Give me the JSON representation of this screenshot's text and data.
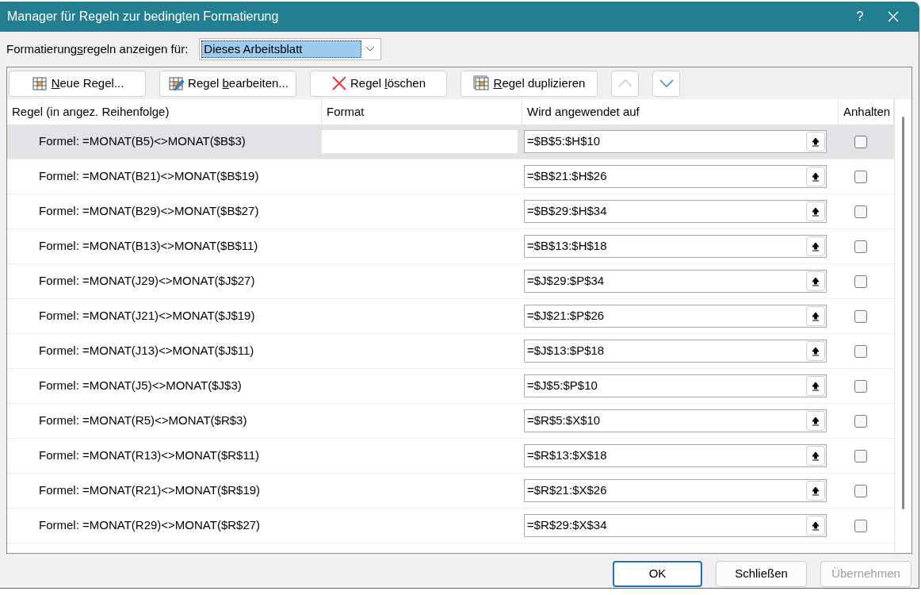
{
  "window": {
    "title": "Manager für Regeln zur bedingten Formatierung",
    "help": "?"
  },
  "scope": {
    "label": [
      {
        "t": "Formatierung",
        "u": false
      },
      {
        "t": "s",
        "u": true
      },
      {
        "t": "regeln anzeigen für:",
        "u": false
      }
    ],
    "value": "Dieses Arbeitsblatt"
  },
  "toolbar": [
    {
      "kind": "new",
      "label": [
        {
          "t": "N",
          "u": true
        },
        {
          "t": "eue Regel...",
          "u": false
        }
      ]
    },
    {
      "kind": "edit",
      "label": [
        {
          "t": "Regel ",
          "u": false
        },
        {
          "t": "b",
          "u": true
        },
        {
          "t": "earbeiten...",
          "u": false
        }
      ]
    },
    {
      "kind": "delete",
      "label": [
        {
          "t": "Regel ",
          "u": false
        },
        {
          "t": "l",
          "u": true
        },
        {
          "t": "öschen",
          "u": false
        }
      ]
    },
    {
      "kind": "duplicate",
      "label": [
        {
          "t": "R",
          "u": true
        },
        {
          "t": "egel duplizieren",
          "u": false
        }
      ]
    },
    {
      "kind": "up",
      "disabled": true
    },
    {
      "kind": "down",
      "disabled": false
    }
  ],
  "table": {
    "columns": [
      "Regel (in angez. Reihenfolge)",
      "Format",
      "Wird angewendet auf",
      "Anhalten"
    ],
    "rows": [
      {
        "rule": "Formel: =MONAT(B5)<>MONAT($B$3)",
        "applies_to": "=$B$5:$H$10",
        "stop": false,
        "selected": true
      },
      {
        "rule": "Formel: =MONAT(B21)<>MONAT($B$19)",
        "applies_to": "=$B$21:$H$26",
        "stop": false,
        "selected": false
      },
      {
        "rule": "Formel: =MONAT(B29)<>MONAT($B$27)",
        "applies_to": "=$B$29:$H$34",
        "stop": false,
        "selected": false
      },
      {
        "rule": "Formel: =MONAT(B13)<>MONAT($B$11)",
        "applies_to": "=$B$13:$H$18",
        "stop": false,
        "selected": false
      },
      {
        "rule": "Formel: =MONAT(J29)<>MONAT($J$27)",
        "applies_to": "=$J$29:$P$34",
        "stop": false,
        "selected": false
      },
      {
        "rule": "Formel: =MONAT(J21)<>MONAT($J$19)",
        "applies_to": "=$J$21:$P$26",
        "stop": false,
        "selected": false
      },
      {
        "rule": "Formel: =MONAT(J13)<>MONAT($J$11)",
        "applies_to": "=$J$13:$P$18",
        "stop": false,
        "selected": false
      },
      {
        "rule": "Formel: =MONAT(J5)<>MONAT($J$3)",
        "applies_to": "=$J$5:$P$10",
        "stop": false,
        "selected": false
      },
      {
        "rule": "Formel: =MONAT(R5)<>MONAT($R$3)",
        "applies_to": "=$R$5:$X$10",
        "stop": false,
        "selected": false
      },
      {
        "rule": "Formel: =MONAT(R13)<>MONAT($R$11)",
        "applies_to": "=$R$13:$X$18",
        "stop": false,
        "selected": false
      },
      {
        "rule": "Formel: =MONAT(R21)<>MONAT($R$19)",
        "applies_to": "=$R$21:$X$26",
        "stop": false,
        "selected": false
      },
      {
        "rule": "Formel: =MONAT(R29)<>MONAT($R$27)",
        "applies_to": "=$R$29:$X$34",
        "stop": false,
        "selected": false
      }
    ]
  },
  "buttons": [
    {
      "label": "OK",
      "default": true,
      "disabled": false
    },
    {
      "label": "Schließen",
      "default": false,
      "disabled": false
    },
    {
      "label": "Übernehmen",
      "default": false,
      "disabled": true
    }
  ]
}
